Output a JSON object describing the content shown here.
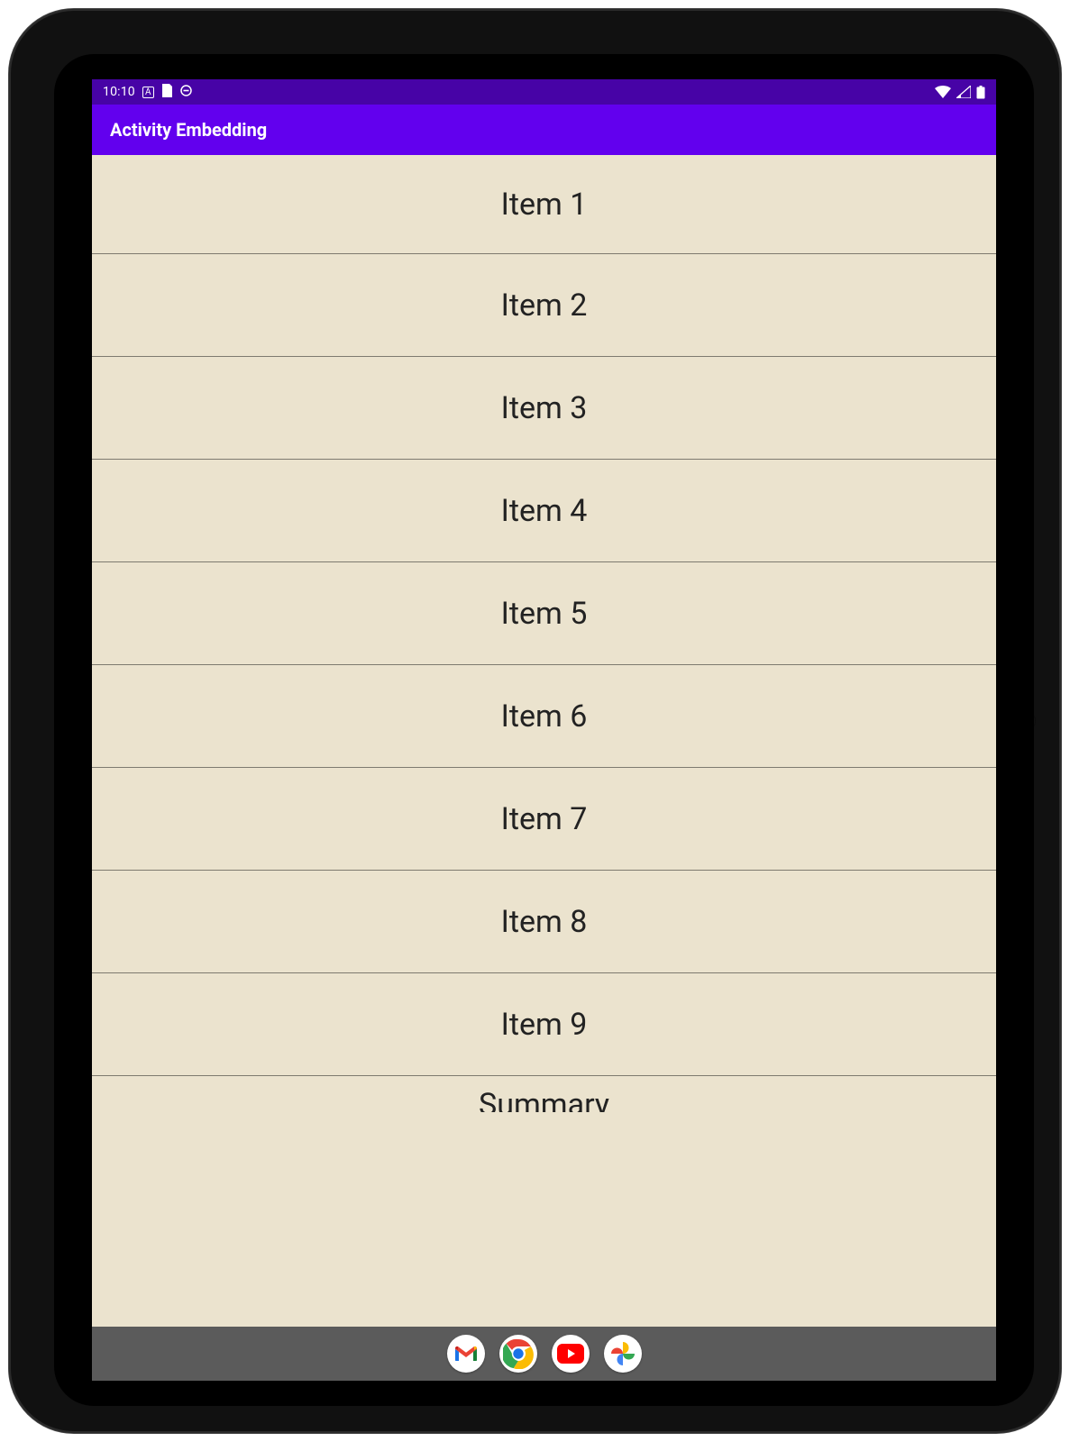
{
  "status_bar": {
    "time": "10:10",
    "text_badge": "A",
    "icons_left": [
      "page-icon",
      "dnd-icon"
    ],
    "icons_right": [
      "wifi-icon",
      "cell-signal-icon",
      "battery-icon"
    ]
  },
  "app_bar": {
    "title": "Activity Embedding"
  },
  "list": {
    "items": [
      "Item 1",
      "Item 2",
      "Item 3",
      "Item 4",
      "Item 5",
      "Item 6",
      "Item 7",
      "Item 8",
      "Item 9",
      "Summary"
    ]
  },
  "dock": {
    "apps": [
      "gmail",
      "chrome",
      "youtube",
      "photos"
    ]
  },
  "colors": {
    "status_bar_bg": "#4703a6",
    "app_bar_bg": "#6200ee",
    "list_bg": "#ebe3ce",
    "divider": "#7e7a6f",
    "nav_bg": "#5b5b5b",
    "bezel": "#111111"
  }
}
